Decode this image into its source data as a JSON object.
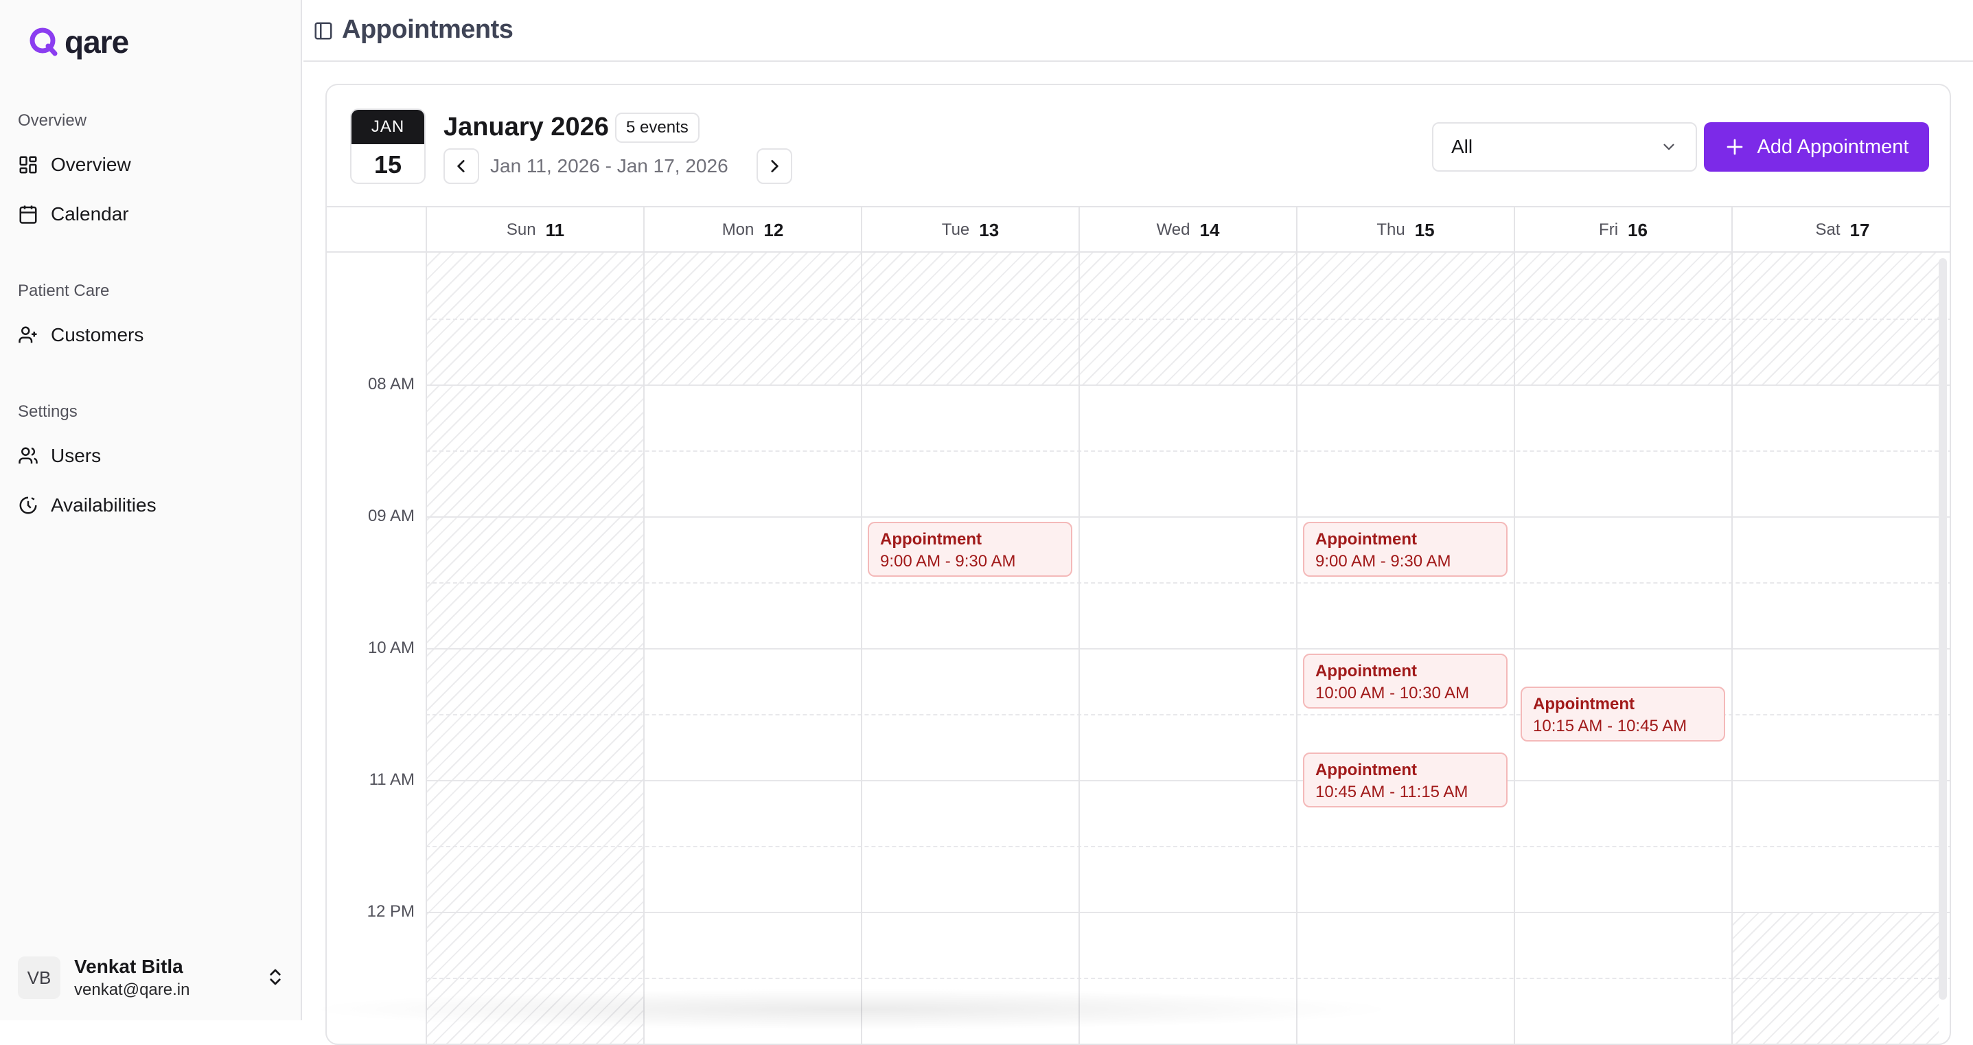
{
  "app": {
    "name": "qare"
  },
  "sidebar": {
    "sections": [
      {
        "label": "Overview",
        "items": [
          {
            "label": "Overview",
            "icon": "dashboard-icon"
          },
          {
            "label": "Calendar",
            "icon": "calendar-icon"
          }
        ]
      },
      {
        "label": "Patient Care",
        "items": [
          {
            "label": "Customers",
            "icon": "user-plus-icon"
          }
        ]
      },
      {
        "label": "Settings",
        "items": [
          {
            "label": "Users",
            "icon": "users-icon"
          },
          {
            "label": "Availabilities",
            "icon": "clock-history-icon"
          }
        ]
      }
    ],
    "user": {
      "initials": "VB",
      "name": "Venkat Bitla",
      "email": "venkat@qare.in"
    }
  },
  "header": {
    "title": "Appointments"
  },
  "calendar": {
    "badge": {
      "month": "JAN",
      "day": "15"
    },
    "title": "January 2026",
    "events_count": "5 events",
    "range": "Jan 11, 2026 - Jan 17, 2026",
    "filter": {
      "selected": "All"
    },
    "add_button": "Add Appointment",
    "days": [
      {
        "name": "Sun",
        "num": "11"
      },
      {
        "name": "Mon",
        "num": "12"
      },
      {
        "name": "Tue",
        "num": "13"
      },
      {
        "name": "Wed",
        "num": "14"
      },
      {
        "name": "Thu",
        "num": "15"
      },
      {
        "name": "Fri",
        "num": "16"
      },
      {
        "name": "Sat",
        "num": "17"
      }
    ],
    "time_labels": [
      "08 AM",
      "09 AM",
      "10 AM",
      "11 AM",
      "12 PM"
    ],
    "appointments": [
      {
        "title": "Appointment",
        "range": "9:00 AM - 9:30 AM",
        "day": "Tue"
      },
      {
        "title": "Appointment",
        "range": "9:00 AM - 9:30 AM",
        "day": "Thu"
      },
      {
        "title": "Appointment",
        "range": "10:00 AM - 10:30 AM",
        "day": "Thu"
      },
      {
        "title": "Appointment",
        "range": "10:15 AM - 10:45 AM",
        "day": "Fri"
      },
      {
        "title": "Appointment",
        "range": "10:45 AM - 11:15 AM",
        "day": "Thu"
      }
    ]
  },
  "colors": {
    "accent": "#7c2ae8",
    "appointment_text": "#a11a1a",
    "appointment_bg": "#fdf0f0"
  }
}
